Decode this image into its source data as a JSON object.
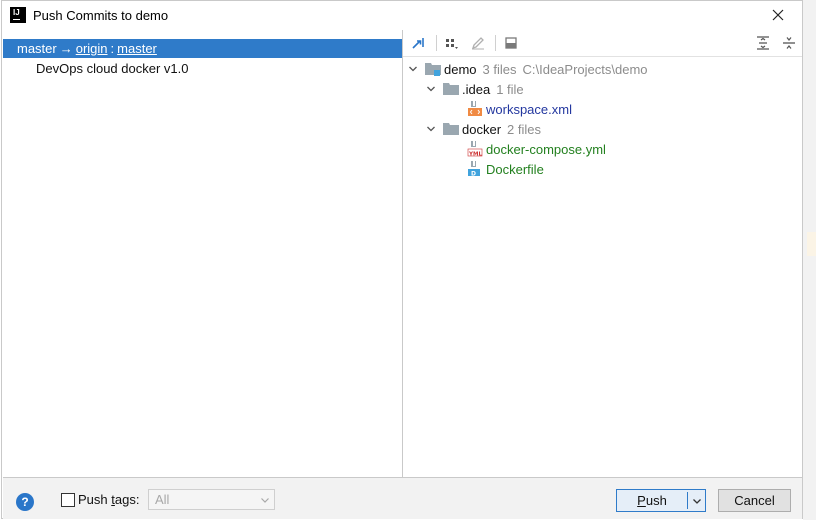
{
  "window": {
    "title": "Push Commits to demo"
  },
  "branches": {
    "local": "master",
    "arrow": "→",
    "remote": "origin",
    "separator": ":",
    "target": "master",
    "commits": [
      "DevOps cloud docker v1.0"
    ]
  },
  "tree": {
    "root": {
      "name": "demo",
      "count": "3 files",
      "path": "C:\\IdeaProjects\\demo"
    },
    "idea": {
      "name": ".idea",
      "count": "1 file",
      "files": [
        "workspace.xml"
      ]
    },
    "docker": {
      "name": "docker",
      "count": "2 files",
      "files": [
        "docker-compose.yml",
        "Dockerfile"
      ]
    }
  },
  "toolbar": {
    "icons": [
      "jump-to-source-icon",
      "group-by-icon",
      "edit-icon",
      "preview-icon",
      "expand-all-icon",
      "collapse-all-icon"
    ]
  },
  "footer": {
    "help": "?",
    "push_tags_prefix": "Push ",
    "push_tags_mnemonic": "t",
    "push_tags_suffix": "ags:",
    "push_tags_checked": false,
    "tags_option": "All",
    "push_mnemonic": "P",
    "push_rest": "ush",
    "cancel": "Cancel"
  },
  "colors": {
    "selection": "#2f7bc9",
    "file_modified": "#23379f",
    "file_added": "#23801f",
    "meta": "#8c8c8c"
  }
}
